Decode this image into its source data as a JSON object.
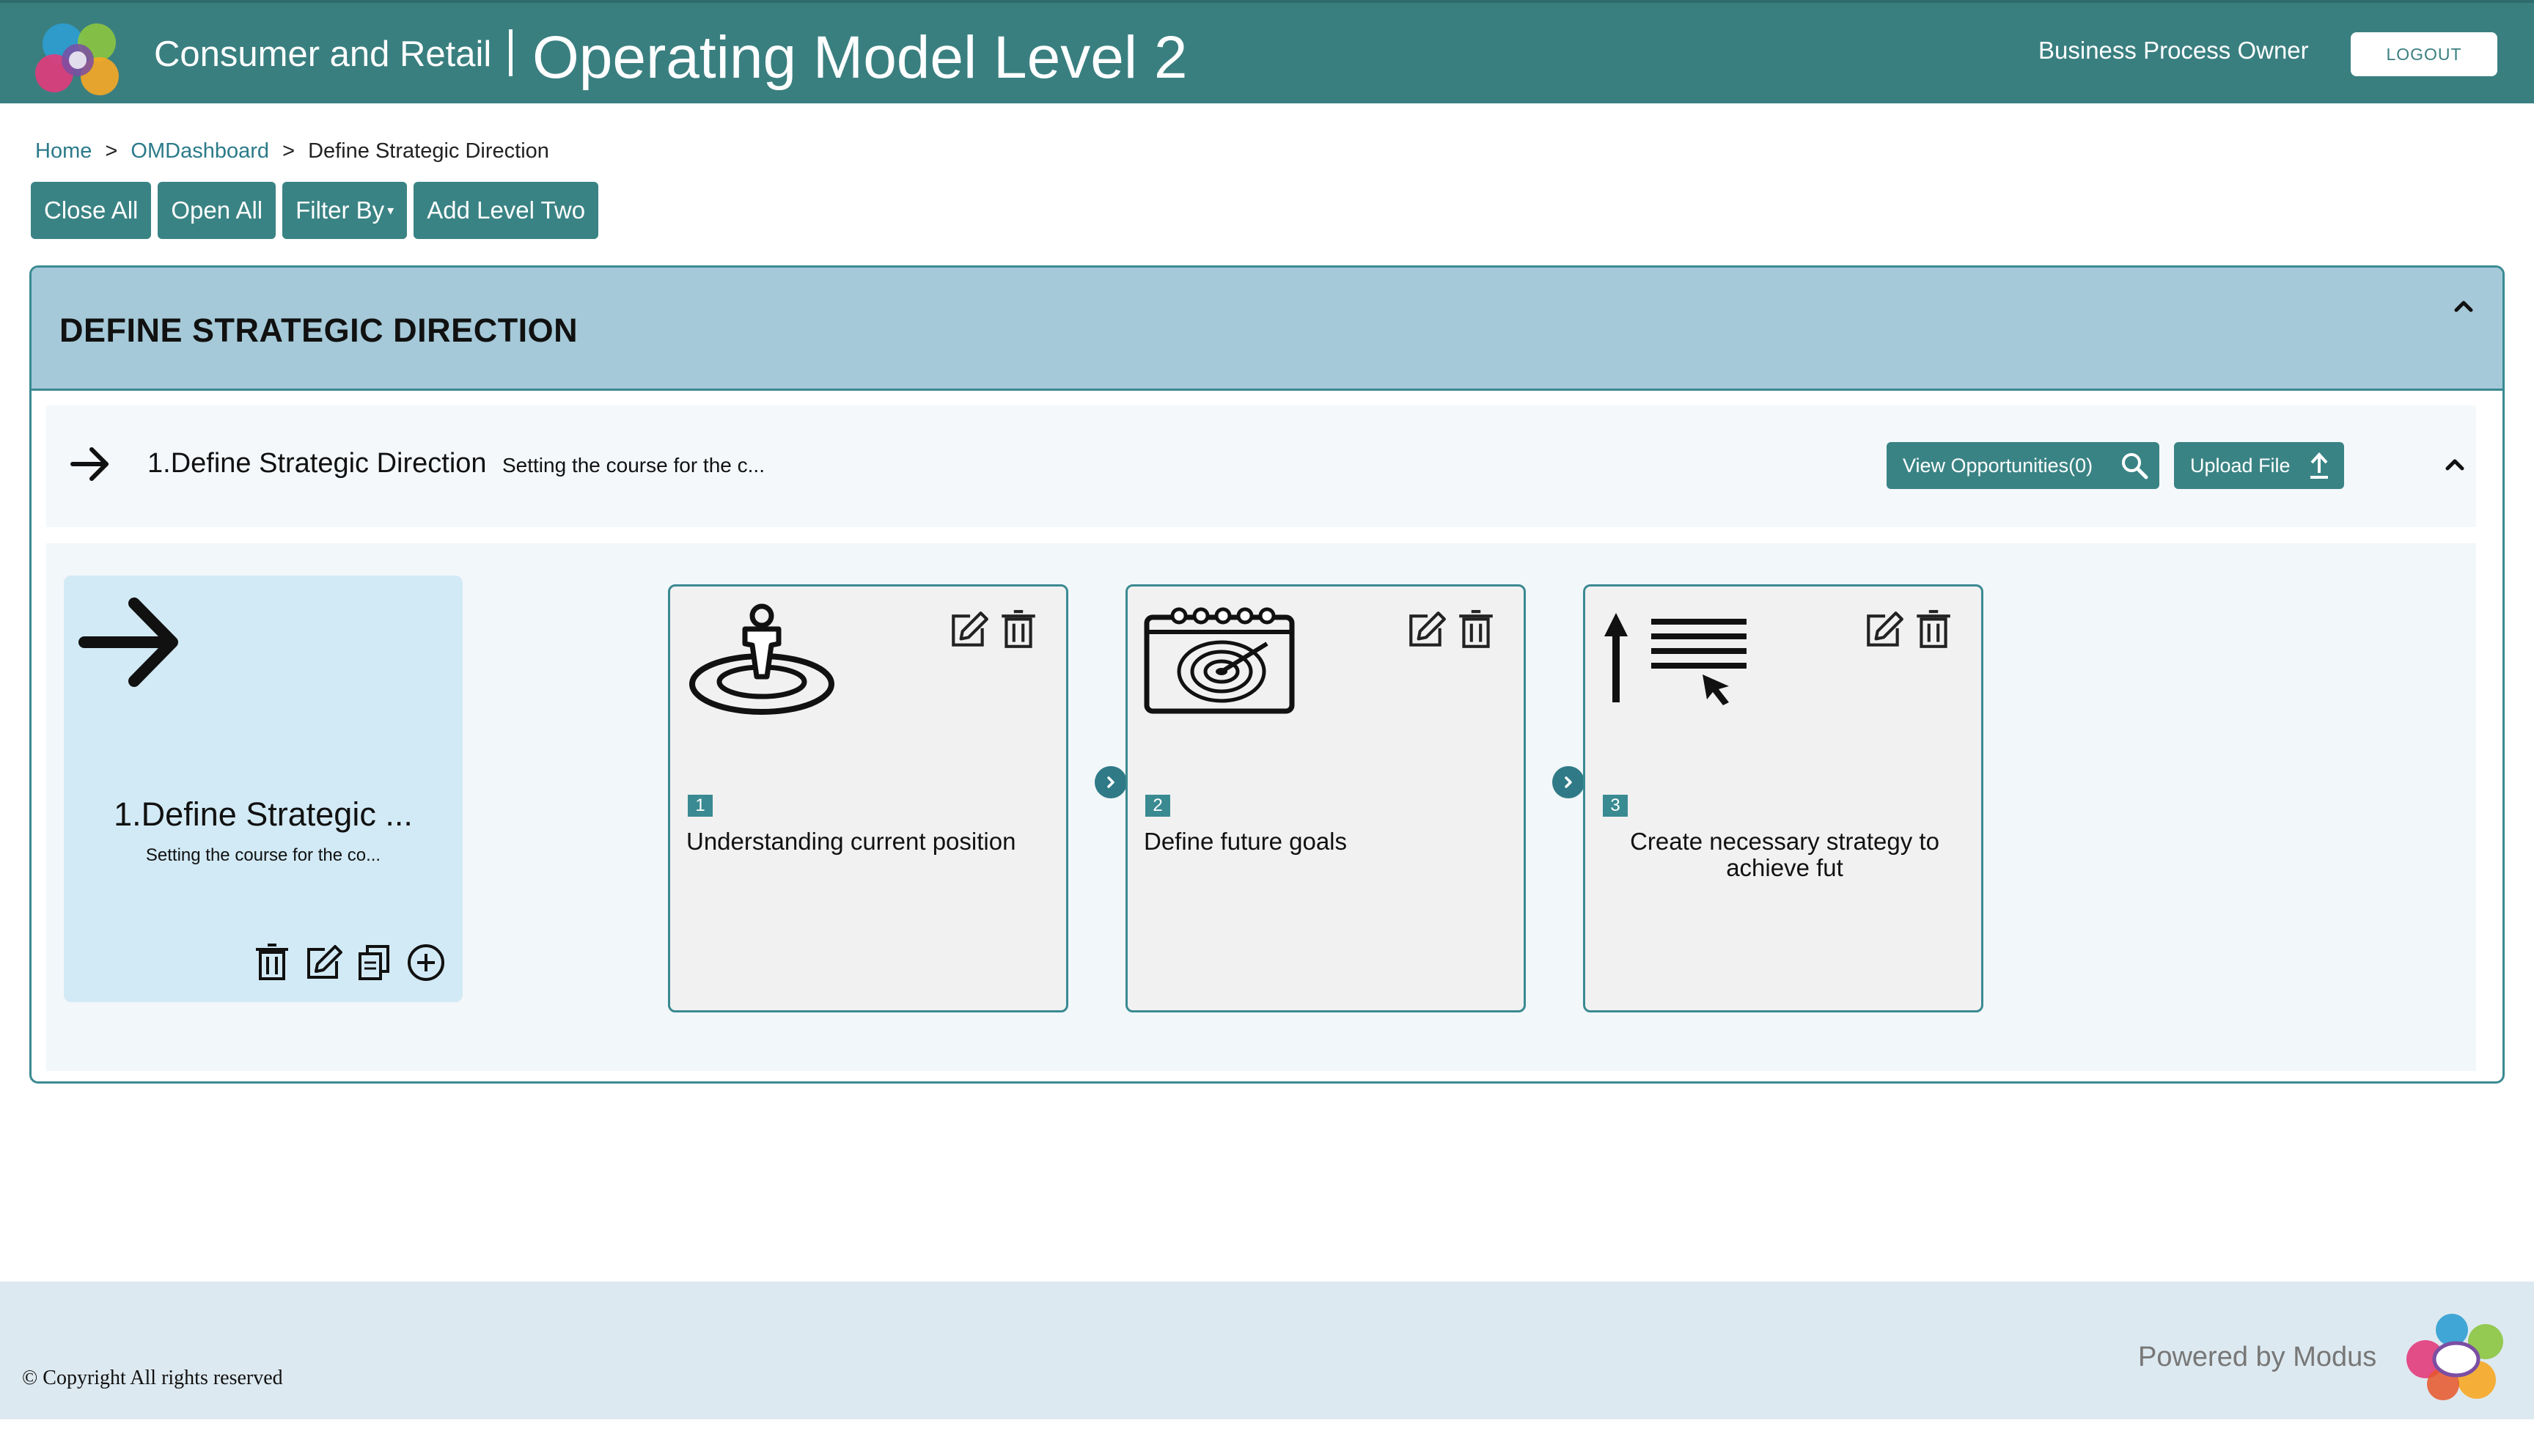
{
  "header": {
    "app_name": "Consumer and Retail",
    "page_heading": "Operating Model Level 2",
    "role": "Business Process Owner",
    "logout_label": "LOGOUT"
  },
  "breadcrumb": {
    "items": [
      "Home",
      "OMDashboard",
      "Define Strategic Direction"
    ],
    "separator": ">"
  },
  "toolbar": {
    "close_all": "Close All",
    "open_all": "Open All",
    "filter_by": "Filter By",
    "add_level_two": "Add Level Two"
  },
  "panel": {
    "title": "DEFINE STRATEGIC DIRECTION",
    "row": {
      "title": "1.Define Strategic Direction",
      "description": "Setting the course for the c...",
      "view_opportunities": "View Opportunities(0)",
      "upload_file": "Upload File"
    },
    "level1_card": {
      "title": "1.Define Strategic ...",
      "description": "Setting the course for the co..."
    },
    "steps": [
      {
        "number": "1",
        "label": "Understanding current position",
        "icon": "person-on-target-icon"
      },
      {
        "number": "2",
        "label": "Define future goals",
        "icon": "calendar-target-icon"
      },
      {
        "number": "3",
        "label": "Create necessary strategy to achieve fut",
        "icon": "arrow-list-cursor-icon"
      }
    ]
  },
  "footer": {
    "copyright": "© Copyright All rights reserved",
    "powered_by": "Powered by Modus"
  },
  "colors": {
    "brand_teal": "#3a7f80",
    "panel_header": "#a5c9d8",
    "card_blue": "#d2eaf5",
    "footer_bg": "#dde9f0"
  }
}
